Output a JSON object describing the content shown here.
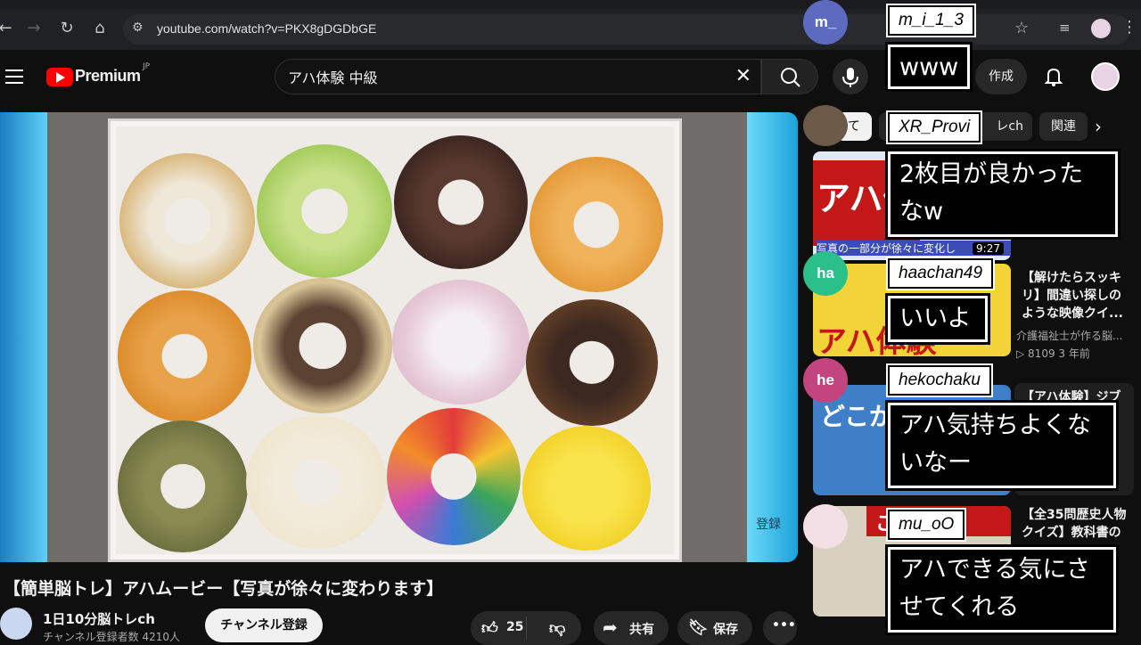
{
  "browser": {
    "url": "youtube.com/watch?v=PKX8gDGDbGE"
  },
  "header": {
    "brand": "Premium",
    "region": "JP",
    "search_value": "アハ体験 中級",
    "create_label": "作成"
  },
  "player": {
    "watermark": "登録"
  },
  "video": {
    "title": "【簡単脳トレ】アハムービー【写真が徐々に変わります】",
    "channel_name": "1日10分脳トレch",
    "channel_subs": "チャンネル登録者数 4210人",
    "subscribe_label": "チャンネル登録",
    "likes": "25",
    "share_label": "共有",
    "save_label": "保存"
  },
  "sidebar": {
    "chips": [
      "て",
      "レch",
      "関連"
    ],
    "recommendations": [
      {
        "title": "",
        "duration": "9:27",
        "thumb_text": "アハ体験",
        "thumb_caption": "写真の一部分が徐々に変化し"
      },
      {
        "title": "【解けたらスッキリ】間違い探しのような映像クイ...",
        "channel": "介護福祉士が作る脳...",
        "meta": "▷ 8109  3 年前",
        "thumb_text": "アハ体験"
      },
      {
        "title": "【アハ体験】ジブ",
        "thumb_text": "どこが"
      },
      {
        "title": "【全35問歴史人物クイズ】教科書の",
        "thumb_text": "この人"
      }
    ]
  },
  "chat": [
    {
      "initials": "m_",
      "name": "m_i_1_3",
      "text": "www",
      "avatar_color": "#5c6bc0"
    },
    {
      "initials": "",
      "name": "XR_Provi",
      "text": "2枚目が良かったなw",
      "avatar_color": "#6b5a48"
    },
    {
      "initials": "ha",
      "name": "haachan49",
      "text": "いいよ",
      "avatar_color": "#2bbf8a"
    },
    {
      "initials": "he",
      "name": "hekochaku",
      "text": "アハ気持ちよくないなー",
      "avatar_color": "#c2457f"
    },
    {
      "initials": "",
      "name": "mu_oO",
      "text": "アハできる気にさせてくれる",
      "avatar_color": "#f3dfe6"
    }
  ]
}
